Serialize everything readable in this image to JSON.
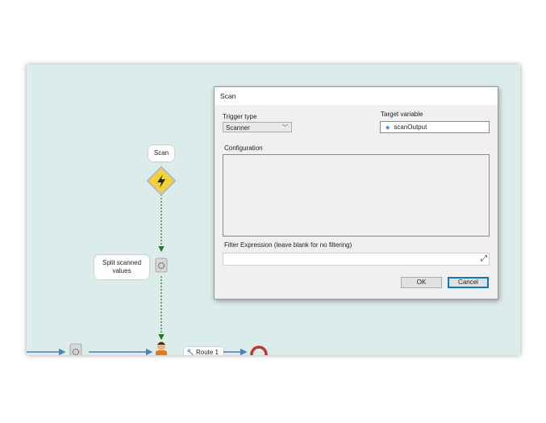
{
  "canvas": {
    "nodes": {
      "scan": {
        "label": "Scan"
      },
      "split": {
        "label": "Split scanned values"
      },
      "route": {
        "label": "Route 1"
      }
    },
    "colors": {
      "background": "#dcecea",
      "trigger_diamond": "#f3d233",
      "flow_arrow": "#1f7a1f",
      "main_line": "#4a7fc1",
      "end_node": "#c0392b"
    },
    "icons": {
      "trigger": "lightning-bolt-icon",
      "action": "gear-scroll-icon",
      "user": "user-task-icon",
      "route": "wrench-icon",
      "end": "end-ring-icon"
    }
  },
  "dialog": {
    "title": "Scan",
    "trigger_type": {
      "label": "Trigger type",
      "value": "Scanner"
    },
    "target_variable": {
      "label": "Target variable",
      "value": "scanOutput"
    },
    "configuration": {
      "label": "Configuration"
    },
    "filter": {
      "label": "Filter Expression (leave blank for no filtering)",
      "value": ""
    },
    "buttons": {
      "ok": "OK",
      "cancel": "Cancel"
    }
  }
}
